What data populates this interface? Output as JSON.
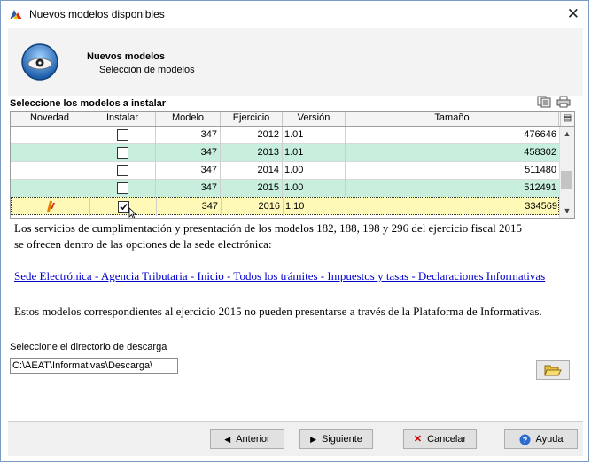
{
  "window": {
    "title": "Nuevos modelos disponibles"
  },
  "header": {
    "title": "Nuevos modelos",
    "subtitle": "Selección de modelos"
  },
  "section": {
    "label": "Seleccione los modelos a instalar"
  },
  "table": {
    "columns": [
      "Novedad",
      "Instalar",
      "Modelo",
      "Ejercicio",
      "Versión",
      "Tamaño"
    ],
    "rows": [
      {
        "novedad": false,
        "instalar": false,
        "modelo": "347",
        "ejercicio": "2012",
        "version": "1.01",
        "tamano": "476646",
        "bg": "#ffffff"
      },
      {
        "novedad": false,
        "instalar": false,
        "modelo": "347",
        "ejercicio": "2013",
        "version": "1.01",
        "tamano": "458302",
        "bg": "#c8eedd"
      },
      {
        "novedad": false,
        "instalar": false,
        "modelo": "347",
        "ejercicio": "2014",
        "version": "1.00",
        "tamano": "511480",
        "bg": "#ffffff"
      },
      {
        "novedad": false,
        "instalar": false,
        "modelo": "347",
        "ejercicio": "2015",
        "version": "1.00",
        "tamano": "512491",
        "bg": "#c8eedd"
      },
      {
        "novedad": true,
        "instalar": true,
        "modelo": "347",
        "ejercicio": "2016",
        "version": "1.10",
        "tamano": "334569",
        "bg": "#fff9b8"
      }
    ]
  },
  "info": {
    "line1": "Los servicios de cumplimentación y presentación de los modelos 182, 188, 198 y 296 del ejercicio fiscal 2015",
    "line2": "se ofrecen dentro de las opciones de la sede electrónica:",
    "link": "Sede Electrónica - Agencia Tributaria - Inicio - Todos los trámites - Impuestos y tasas - Declaraciones Informativas",
    "note": "Estos modelos correspondientes al ejercicio 2015 no pueden presentarse a través de la Plataforma de Informativas."
  },
  "download": {
    "label": "Seleccione el directorio de descarga",
    "path": "C:\\AEAT\\Informativas\\Descarga\\"
  },
  "buttons": {
    "prev": "Anterior",
    "next": "Siguiente",
    "cancel": "Cancelar",
    "help": "Ayuda"
  },
  "colors": {
    "row_alt": "#c8eedd",
    "row_selected": "#fff9b8",
    "link": "#0000cc"
  }
}
